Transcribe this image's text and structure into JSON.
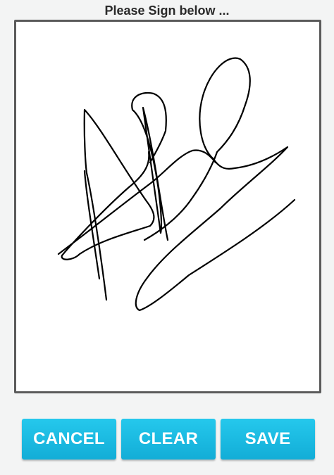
{
  "header": {
    "title": "Please Sign below ..."
  },
  "signature_pad": {
    "ink_color": "#000000",
    "border_color": "#5b5b5b"
  },
  "actions": {
    "cancel_label": "CANCEL",
    "clear_label": "CLEAR",
    "save_label": "SAVE",
    "button_color": "#1ebbe3"
  }
}
